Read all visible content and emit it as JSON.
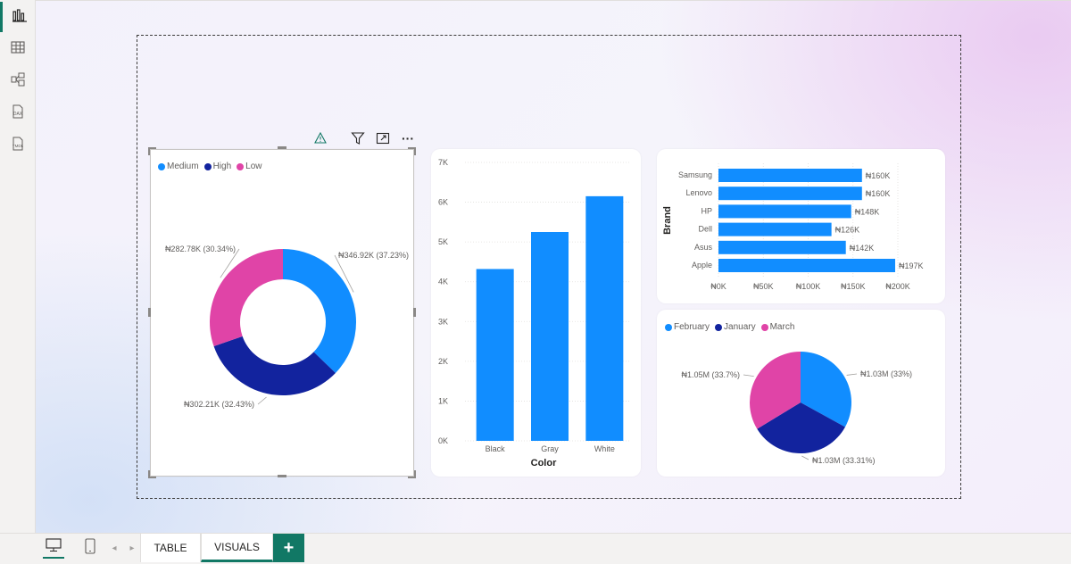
{
  "rail": {
    "items": [
      {
        "name": "report-view-icon",
        "active": true
      },
      {
        "name": "table-view-icon",
        "active": false
      },
      {
        "name": "model-view-icon",
        "active": false
      },
      {
        "name": "dax-query-view-icon",
        "label": "DAX",
        "active": false
      },
      {
        "name": "tmdl-view-icon",
        "label": "TMDL",
        "active": false
      }
    ]
  },
  "colors": {
    "accent": "#117865",
    "medium": "#118DFF",
    "high": "#12239E",
    "low": "#E044A7",
    "bar": "#118DFF"
  },
  "donut_chart": {
    "legend": [
      {
        "label": "Medium",
        "color": "#118DFF"
      },
      {
        "label": "High",
        "color": "#12239E"
      },
      {
        "label": "Low",
        "color": "#E044A7"
      }
    ],
    "slices": [
      {
        "name": "Medium",
        "value": 346.92,
        "label": "₦346.92K (37.23%)"
      },
      {
        "name": "High",
        "value": 302.21,
        "label": "₦302.21K (32.43%)"
      },
      {
        "name": "Low",
        "value": 282.78,
        "label": "₦282.78K (30.34%)"
      }
    ]
  },
  "column_chart": {
    "xlabel": "Color",
    "yticks": [
      "0K",
      "1K",
      "2K",
      "3K",
      "4K",
      "5K",
      "6K",
      "7K"
    ],
    "categories": [
      "Black",
      "Gray",
      "White"
    ],
    "values": [
      4320,
      5250,
      6150
    ],
    "ymax": 7000
  },
  "bar_chart": {
    "ylabel": "Brand",
    "categories": [
      "Samsung",
      "Lenovo",
      "HP",
      "Dell",
      "Asus",
      "Apple"
    ],
    "values": [
      160,
      160,
      148,
      126,
      142,
      197
    ],
    "value_labels": [
      "₦160K",
      "₦160K",
      "₦148K",
      "₦126K",
      "₦142K",
      "₦197K"
    ],
    "xticks": [
      "₦0K",
      "₦50K",
      "₦100K",
      "₦150K",
      "₦200K"
    ],
    "xmax": 200
  },
  "pie_chart": {
    "legend": [
      {
        "label": "February",
        "color": "#118DFF"
      },
      {
        "label": "January",
        "color": "#12239E"
      },
      {
        "label": "March",
        "color": "#E044A7"
      }
    ],
    "slices": [
      {
        "name": "February",
        "value": 33.0,
        "label": "₦1.03M (33%)"
      },
      {
        "name": "January",
        "value": 33.31,
        "label": "₦1.03M (33.31%)"
      },
      {
        "name": "March",
        "value": 33.7,
        "label": "₦1.05M (33.7%)"
      }
    ]
  },
  "toolbar": {
    "warning_icon": "warning-icon",
    "filter_icon": "filter-icon",
    "focus_icon": "focus-mode-icon",
    "more_label": "···"
  },
  "bottom_bar": {
    "tabs": [
      {
        "label": "TABLE",
        "active": false
      },
      {
        "label": "VISUALS",
        "active": true
      }
    ],
    "add_label": "+"
  },
  "chart_data": [
    {
      "type": "pie",
      "categories": [
        "Medium",
        "High",
        "Low"
      ],
      "values": [
        346.92,
        302.21,
        282.78
      ],
      "labels": [
        "₦346.92K (37.23%)",
        "₦302.21K (32.43%)",
        "₦282.78K (30.34%)"
      ],
      "legend": "top-left"
    },
    {
      "type": "bar",
      "categories": [
        "Black",
        "Gray",
        "White"
      ],
      "values": [
        4320,
        5250,
        6150
      ],
      "xlabel": "Color",
      "ylim": [
        0,
        7000
      ],
      "grid": true
    },
    {
      "type": "bar",
      "orientation": "horizontal",
      "categories": [
        "Samsung",
        "Lenovo",
        "HP",
        "Dell",
        "Asus",
        "Apple"
      ],
      "values": [
        160,
        160,
        148,
        126,
        142,
        197
      ],
      "ylabel": "Brand",
      "xlim": [
        0,
        200
      ],
      "grid": true
    },
    {
      "type": "pie",
      "categories": [
        "February",
        "January",
        "March"
      ],
      "values": [
        33.0,
        33.31,
        33.7
      ],
      "labels": [
        "₦1.03M (33%)",
        "₦1.03M (33.31%)",
        "₦1.05M (33.7%)"
      ],
      "legend": "top-left"
    }
  ]
}
